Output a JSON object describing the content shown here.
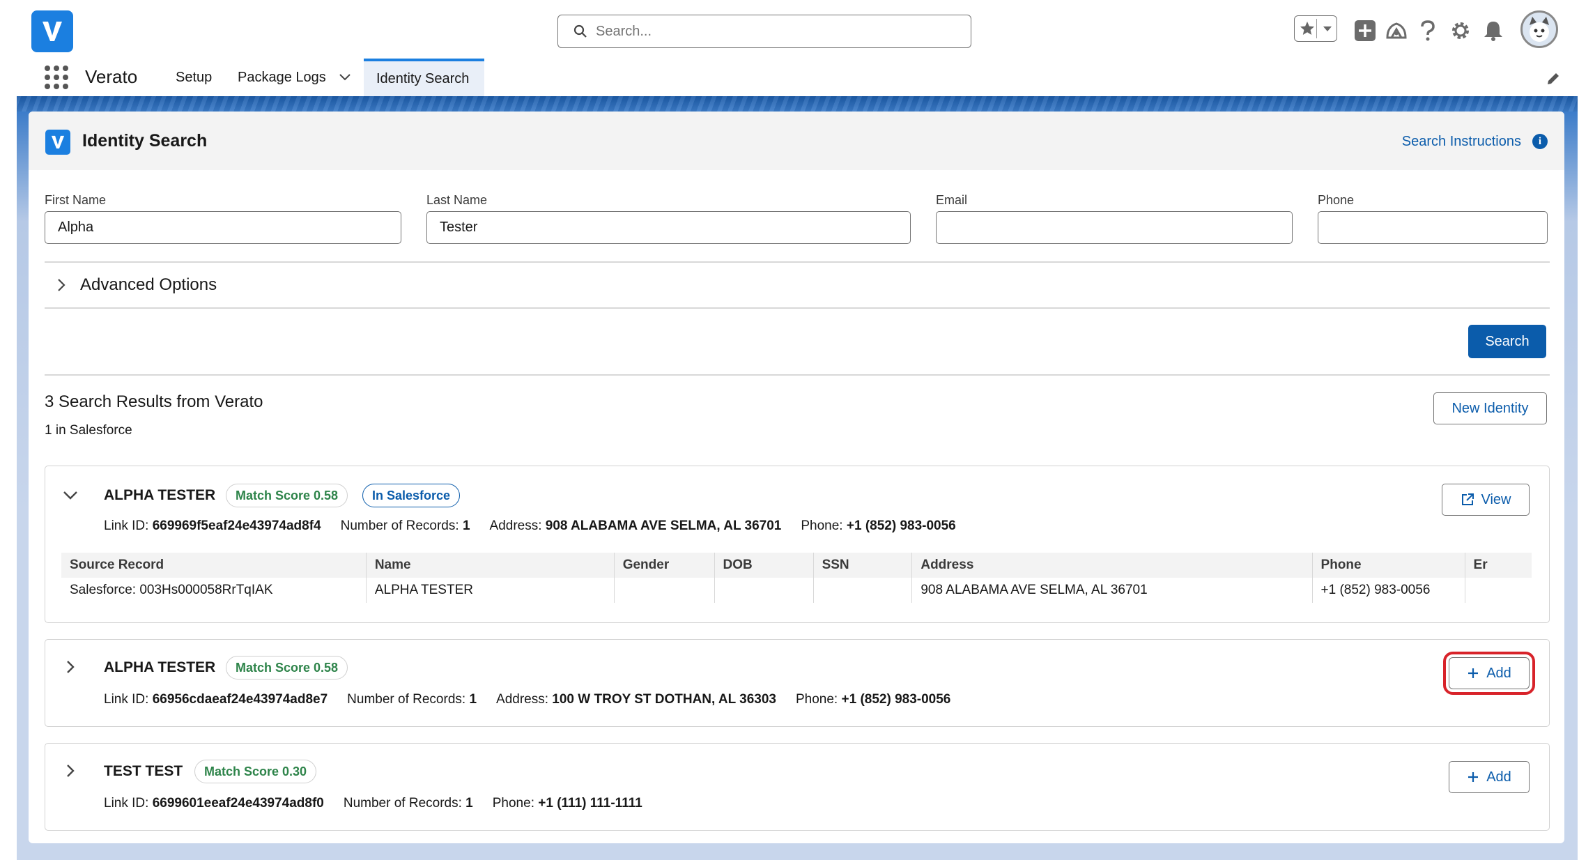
{
  "global": {
    "search_placeholder": "Search...",
    "app_name": "Verato",
    "nav": [
      {
        "label": "Setup"
      },
      {
        "label": "Package Logs"
      },
      {
        "label": "Identity Search"
      }
    ]
  },
  "card": {
    "title": "Identity Search",
    "instructions_link": "Search Instructions",
    "info_glyph": "i",
    "fields": {
      "first_name": {
        "label": "First Name",
        "value": "Alpha"
      },
      "last_name": {
        "label": "Last Name",
        "value": "Tester"
      },
      "email": {
        "label": "Email",
        "value": ""
      },
      "phone": {
        "label": "Phone",
        "value": ""
      }
    },
    "advanced_options": "Advanced Options",
    "search_button": "Search",
    "results_title": "3 Search Results from Verato",
    "results_sub": "1 in Salesforce",
    "new_identity_button": "New Identity"
  },
  "results": [
    {
      "name": "ALPHA TESTER",
      "score": "Match Score 0.58",
      "in_salesforce": "In Salesforce",
      "action": "View",
      "link_id_label": "Link ID:",
      "link_id": "669969f5eaf24e43974ad8f4",
      "records_label": "Number of Records:",
      "records": "1",
      "address_label": "Address:",
      "address": "908 ALABAMA AVE SELMA, AL 36701",
      "phone_label": "Phone:",
      "phone": "+1 (852) 983-0056",
      "table": {
        "headers": [
          "Source Record",
          "Name",
          "Gender",
          "DOB",
          "SSN",
          "Address",
          "Phone",
          "Er"
        ],
        "row": [
          "Salesforce: 003Hs000058RrTqIAK",
          "ALPHA TESTER",
          "",
          "",
          "",
          "908 ALABAMA AVE SELMA, AL 36701",
          "+1 (852) 983-0056",
          ""
        ]
      }
    },
    {
      "name": "ALPHA TESTER",
      "score": "Match Score 0.58",
      "action": "Add",
      "link_id_label": "Link ID:",
      "link_id": "66956cdaeaf24e43974ad8e7",
      "records_label": "Number of Records:",
      "records": "1",
      "address_label": "Address:",
      "address": "100 W TROY ST DOTHAN, AL 36303",
      "phone_label": "Phone:",
      "phone": "+1 (852) 983-0056"
    },
    {
      "name": "TEST TEST",
      "score": "Match Score 0.30",
      "action": "Add",
      "link_id_label": "Link ID:",
      "link_id": "6699601eeaf24e43974ad8f0",
      "records_label": "Number of Records:",
      "records": "1",
      "phone_label": "Phone:",
      "phone": "+1 (111) 111-1111"
    }
  ],
  "colors": {
    "brand": "#0b5cab",
    "logo": "#1b7fe0",
    "score_green": "#2e844a",
    "highlight_red": "#d8232a"
  },
  "icons": [
    "verato-logo-icon",
    "search-icon",
    "star-icon",
    "caret-down-icon",
    "add-icon",
    "trailhead-icon",
    "help-icon",
    "gear-icon",
    "bell-icon",
    "waffle-icon",
    "chevron-down-icon",
    "pencil-icon",
    "info-icon",
    "chevron-right-icon",
    "external-link-icon",
    "plus-icon"
  ]
}
